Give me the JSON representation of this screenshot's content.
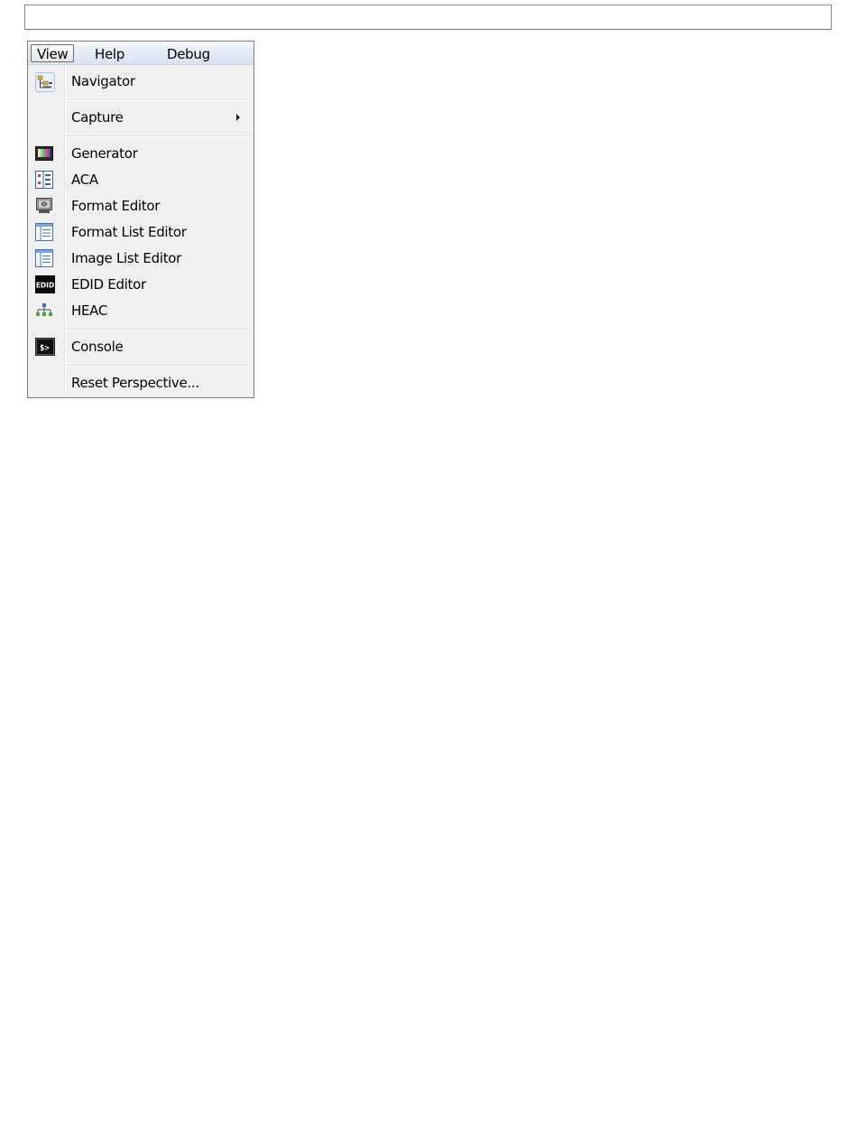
{
  "menubar": {
    "items": [
      {
        "label": "View",
        "active": true
      },
      {
        "label": "Help",
        "active": false
      },
      {
        "label": "Debug",
        "active": false
      }
    ]
  },
  "view_menu": {
    "items": [
      {
        "label": "Navigator",
        "icon": "navigator-icon"
      },
      {
        "label": "Capture",
        "icon": null,
        "has_submenu": true
      },
      {
        "label": "Generator",
        "icon": "generator-icon"
      },
      {
        "label": "ACA",
        "icon": "aca-icon"
      },
      {
        "label": "Format Editor",
        "icon": "format-editor-icon"
      },
      {
        "label": "Format List Editor",
        "icon": "format-list-editor-icon"
      },
      {
        "label": "Image List Editor",
        "icon": "image-list-editor-icon"
      },
      {
        "label": "EDID Editor",
        "icon": "edid-editor-icon",
        "icon_text": "EDID"
      },
      {
        "label": "HEAC",
        "icon": "heac-icon"
      },
      {
        "label": "Console",
        "icon": "console-icon",
        "icon_text": "$>"
      },
      {
        "label": "Reset Perspective...",
        "icon": null
      }
    ]
  },
  "colors": {
    "menubar_gradient_top": "#f7f9fd",
    "menubar_gradient_bottom": "#d9e3f2",
    "menu_background": "#f0f0f0",
    "list_icon_blue": "#3a74c4"
  }
}
